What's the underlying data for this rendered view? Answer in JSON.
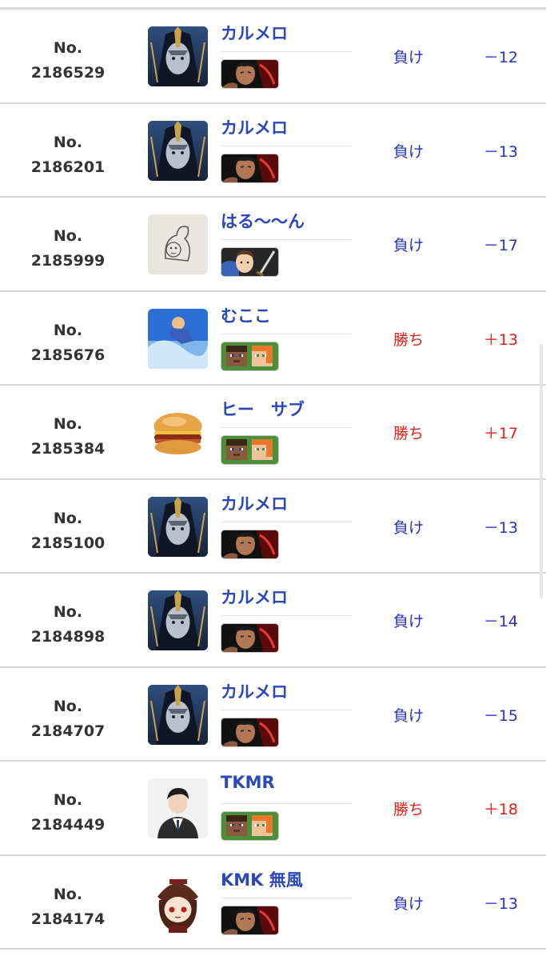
{
  "rows": [
    {
      "no_label": "No.",
      "no": "2186529",
      "player": "カルメロ",
      "avatar": "dark-haired-warrior-avatar",
      "fighter": "kazuya-fighter-icon",
      "result": "負け",
      "result_type": "lose",
      "delta": "－12"
    },
    {
      "no_label": "No.",
      "no": "2186201",
      "player": "カルメロ",
      "avatar": "dark-haired-warrior-avatar",
      "fighter": "kazuya-fighter-icon",
      "result": "負け",
      "result_type": "lose",
      "delta": "－13"
    },
    {
      "no_label": "No.",
      "no": "2185999",
      "player": "はる～～ん",
      "avatar": "sketch-doodle-avatar",
      "fighter": "mii-swordfighter-icon",
      "result": "負け",
      "result_type": "lose",
      "delta": "－17"
    },
    {
      "no_label": "No.",
      "no": "2185676",
      "player": "むここ",
      "avatar": "blue-action-scene-avatar",
      "fighter": "steve-alex-icon",
      "result": "勝ち",
      "result_type": "win",
      "delta": "＋13"
    },
    {
      "no_label": "No.",
      "no": "2185384",
      "player": "ヒー　サブ",
      "avatar": "burger-avatar",
      "fighter": "steve-alex-icon",
      "result": "勝ち",
      "result_type": "win",
      "delta": "＋17"
    },
    {
      "no_label": "No.",
      "no": "2185100",
      "player": "カルメロ",
      "avatar": "dark-haired-warrior-avatar",
      "fighter": "kazuya-fighter-icon",
      "result": "負け",
      "result_type": "lose",
      "delta": "－13"
    },
    {
      "no_label": "No.",
      "no": "2184898",
      "player": "カルメロ",
      "avatar": "dark-haired-warrior-avatar",
      "fighter": "kazuya-fighter-icon",
      "result": "負け",
      "result_type": "lose",
      "delta": "－14"
    },
    {
      "no_label": "No.",
      "no": "2184707",
      "player": "カルメロ",
      "avatar": "dark-haired-warrior-avatar",
      "fighter": "kazuya-fighter-icon",
      "result": "負け",
      "result_type": "lose",
      "delta": "－15"
    },
    {
      "no_label": "No.",
      "no": "2184449",
      "player": "TKMR",
      "avatar": "person-in-suit-avatar",
      "fighter": "steve-alex-icon",
      "result": "勝ち",
      "result_type": "win",
      "delta": "＋18"
    },
    {
      "no_label": "No.",
      "no": "2184174",
      "player": "KMK 無風",
      "avatar": "chibi-girl-avatar",
      "fighter": "kazuya-fighter-icon",
      "result": "負け",
      "result_type": "lose",
      "delta": "－13"
    }
  ],
  "colors": {
    "win": "#e0201a",
    "lose": "#2531b8",
    "player_name": "#2b47b8"
  }
}
